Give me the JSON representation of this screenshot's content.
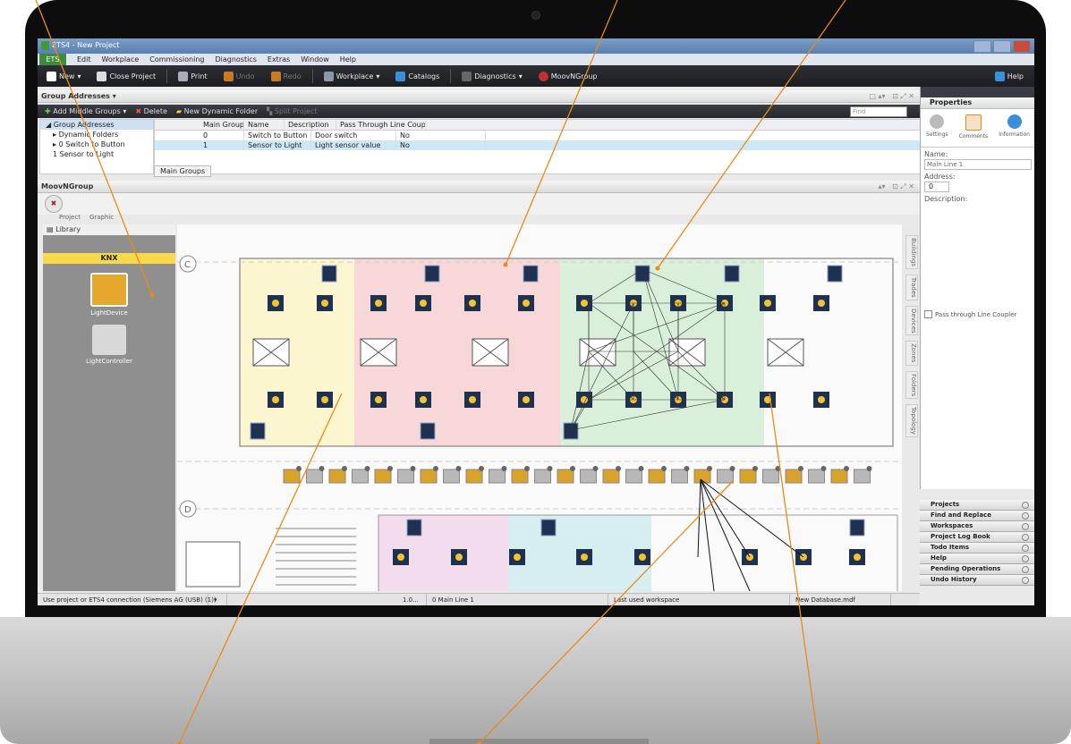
{
  "window": {
    "title": "ETS4 - New Project"
  },
  "menu": {
    "app_button": "ETS",
    "items": [
      "Edit",
      "Workplace",
      "Commissioning",
      "Diagnostics",
      "Extras",
      "Window",
      "Help"
    ]
  },
  "toolbar": {
    "new": "New",
    "close_project": "Close Project",
    "print": "Print",
    "undo": "Undo",
    "redo": "Redo",
    "workplace": "Workplace",
    "catalogs": "Catalogs",
    "diagnostics": "Diagnostics",
    "moovngroup": "MoovNGroup",
    "help": "Help"
  },
  "group_addresses": {
    "panel_title": "Group Addresses",
    "toolbar": {
      "add_middle_groups": "Add Middle Groups",
      "delete": "Delete",
      "new_dynamic_folder": "New Dynamic Folder",
      "split_project": "Split Project",
      "find_placeholder": "Find"
    },
    "tree": [
      "Group Addresses",
      "Dynamic Folders",
      "0 Switch to Button",
      "1 Sensor to Light"
    ],
    "columns": [
      "Main Group",
      "Name",
      "Description",
      "Pass Through Line Coupler"
    ],
    "rows": [
      [
        "0",
        "Switch to Button",
        "Door switch",
        "No"
      ],
      [
        "1",
        "Sensor to Light",
        "Light sensor value",
        "No"
      ]
    ],
    "tab": "Main Groups"
  },
  "moovngroup": {
    "panel_title": "MoovNGroup",
    "tabs": [
      "Project",
      "Graphic"
    ],
    "library": {
      "title": "Library",
      "category": "KNX",
      "devices": [
        "LightDevice",
        "LightController"
      ]
    },
    "grid_labels": [
      "C",
      "D"
    ],
    "side_tabs": [
      "Buildings",
      "Trades",
      "Devices",
      "Zones",
      "Folders",
      "Topology"
    ]
  },
  "properties": {
    "title": "Properties",
    "tabs": [
      "Settings",
      "Comments",
      "Information"
    ],
    "name_label": "Name:",
    "name_value": "Main Line 1",
    "address_label": "Address:",
    "address_value": "0",
    "description_label": "Description:",
    "pass_through_label": "Pass through Line Coupler"
  },
  "side_panels": [
    "Projects",
    "Find and Replace",
    "Workspaces",
    "Project Log Book",
    "Todo Items",
    "Help",
    "Pending Operations",
    "Undo History"
  ],
  "statusbar": {
    "connection": "Use project or ETS4 connection (Siemens AG (USB) (1))",
    "version": "1.0...",
    "line": "0 Main Line 1",
    "workspace": "Last used workspace",
    "database": "New Database.mdf"
  },
  "colors": {
    "accent_orange": "#e88a1a",
    "ets_green": "#3d8c3d",
    "zone_yellow": "#fbf6cf",
    "zone_red": "#f7d7d7",
    "zone_green": "#d9efd9",
    "zone_pink": "#f3dcec",
    "zone_cyan": "#d6eef0"
  }
}
